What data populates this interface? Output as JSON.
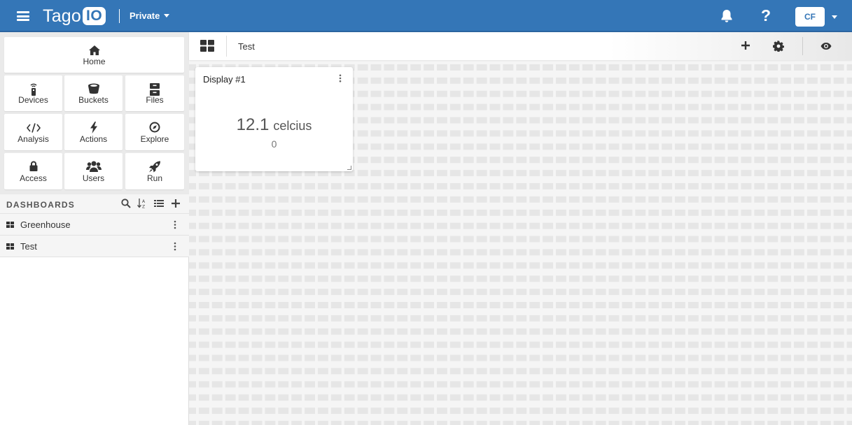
{
  "header": {
    "brand_text": "Tago",
    "brand_badge": "IO",
    "account_scope": "Private",
    "user_initials": "CF",
    "accent_color": "#3476b7"
  },
  "sidebar": {
    "tiles": [
      {
        "label": "Home",
        "icon": "home-icon"
      },
      {
        "label": "Devices",
        "icon": "device-icon"
      },
      {
        "label": "Buckets",
        "icon": "bucket-icon"
      },
      {
        "label": "Files",
        "icon": "files-icon"
      },
      {
        "label": "Analysis",
        "icon": "code-icon"
      },
      {
        "label": "Actions",
        "icon": "bolt-icon"
      },
      {
        "label": "Explore",
        "icon": "compass-icon"
      },
      {
        "label": "Access",
        "icon": "lock-icon"
      },
      {
        "label": "Users",
        "icon": "users-icon"
      },
      {
        "label": "Run",
        "icon": "rocket-icon"
      }
    ],
    "dashboards_title": "DASHBOARDS",
    "dashboards": [
      {
        "label": "Greenhouse"
      },
      {
        "label": "Test"
      }
    ]
  },
  "main": {
    "dashboard_title": "Test",
    "widget": {
      "title": "Display #1",
      "value": "12.1",
      "unit": "celcius",
      "subvalue": "0"
    }
  }
}
